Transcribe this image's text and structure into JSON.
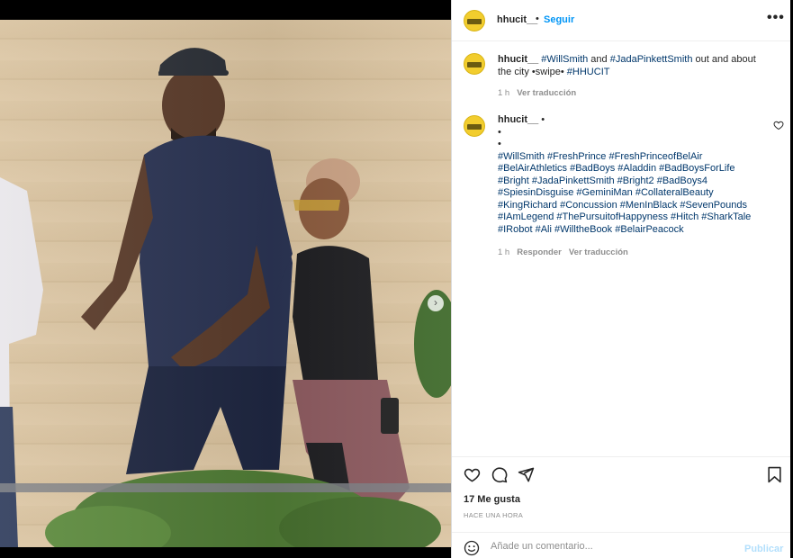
{
  "post": {
    "username": "hhucit__",
    "separator": "•",
    "follow_label": "Seguir",
    "more_label": "•••"
  },
  "caption": {
    "username": "hhucit__",
    "segments": [
      {
        "text": "#WillSmith",
        "tag": true
      },
      {
        "text": " and ",
        "tag": false
      },
      {
        "text": "#JadaPinkettSmith",
        "tag": true
      },
      {
        "text": " out and about the city •swipe• ",
        "tag": false
      },
      {
        "text": "#HHUCIT",
        "tag": true
      }
    ],
    "age": "1 h",
    "translate_label": "Ver traducción"
  },
  "comment": {
    "username": "hhucit__",
    "bullet": "•",
    "lines": [
      "•",
      "•"
    ],
    "hashtags": "#WillSmith #FreshPrince #FreshPrinceofBelAir #BelAirAthletics #BadBoys #Aladdin #BadBoysForLife #Bright #JadaPinkettSmith #Bright2 #BadBoys4 #SpiesinDisguise #GeminiMan #CollateralBeauty #KingRichard #Concussion #MenInBlack #SevenPounds #IAmLegend #ThePursuitofHappyness #Hitch #SharkTale #IRobot #Ali #WilltheBook #BelairPeacock",
    "age": "1 h",
    "reply_label": "Responder",
    "translate_label": "Ver traducción"
  },
  "stats": {
    "likes": "17 Me gusta",
    "timestamp": "HACE UNA HORA"
  },
  "comment_box": {
    "placeholder": "Añade un comentario...",
    "publish_label": "Publicar"
  },
  "carousel": {
    "next_icon": "chevron-right-icon",
    "slides": 3,
    "active": 1
  },
  "colors": {
    "link": "#00376b",
    "accent": "#0095f6",
    "publish_disabled": "#b2dffc",
    "avatar_bg": "#f2cd2e"
  }
}
